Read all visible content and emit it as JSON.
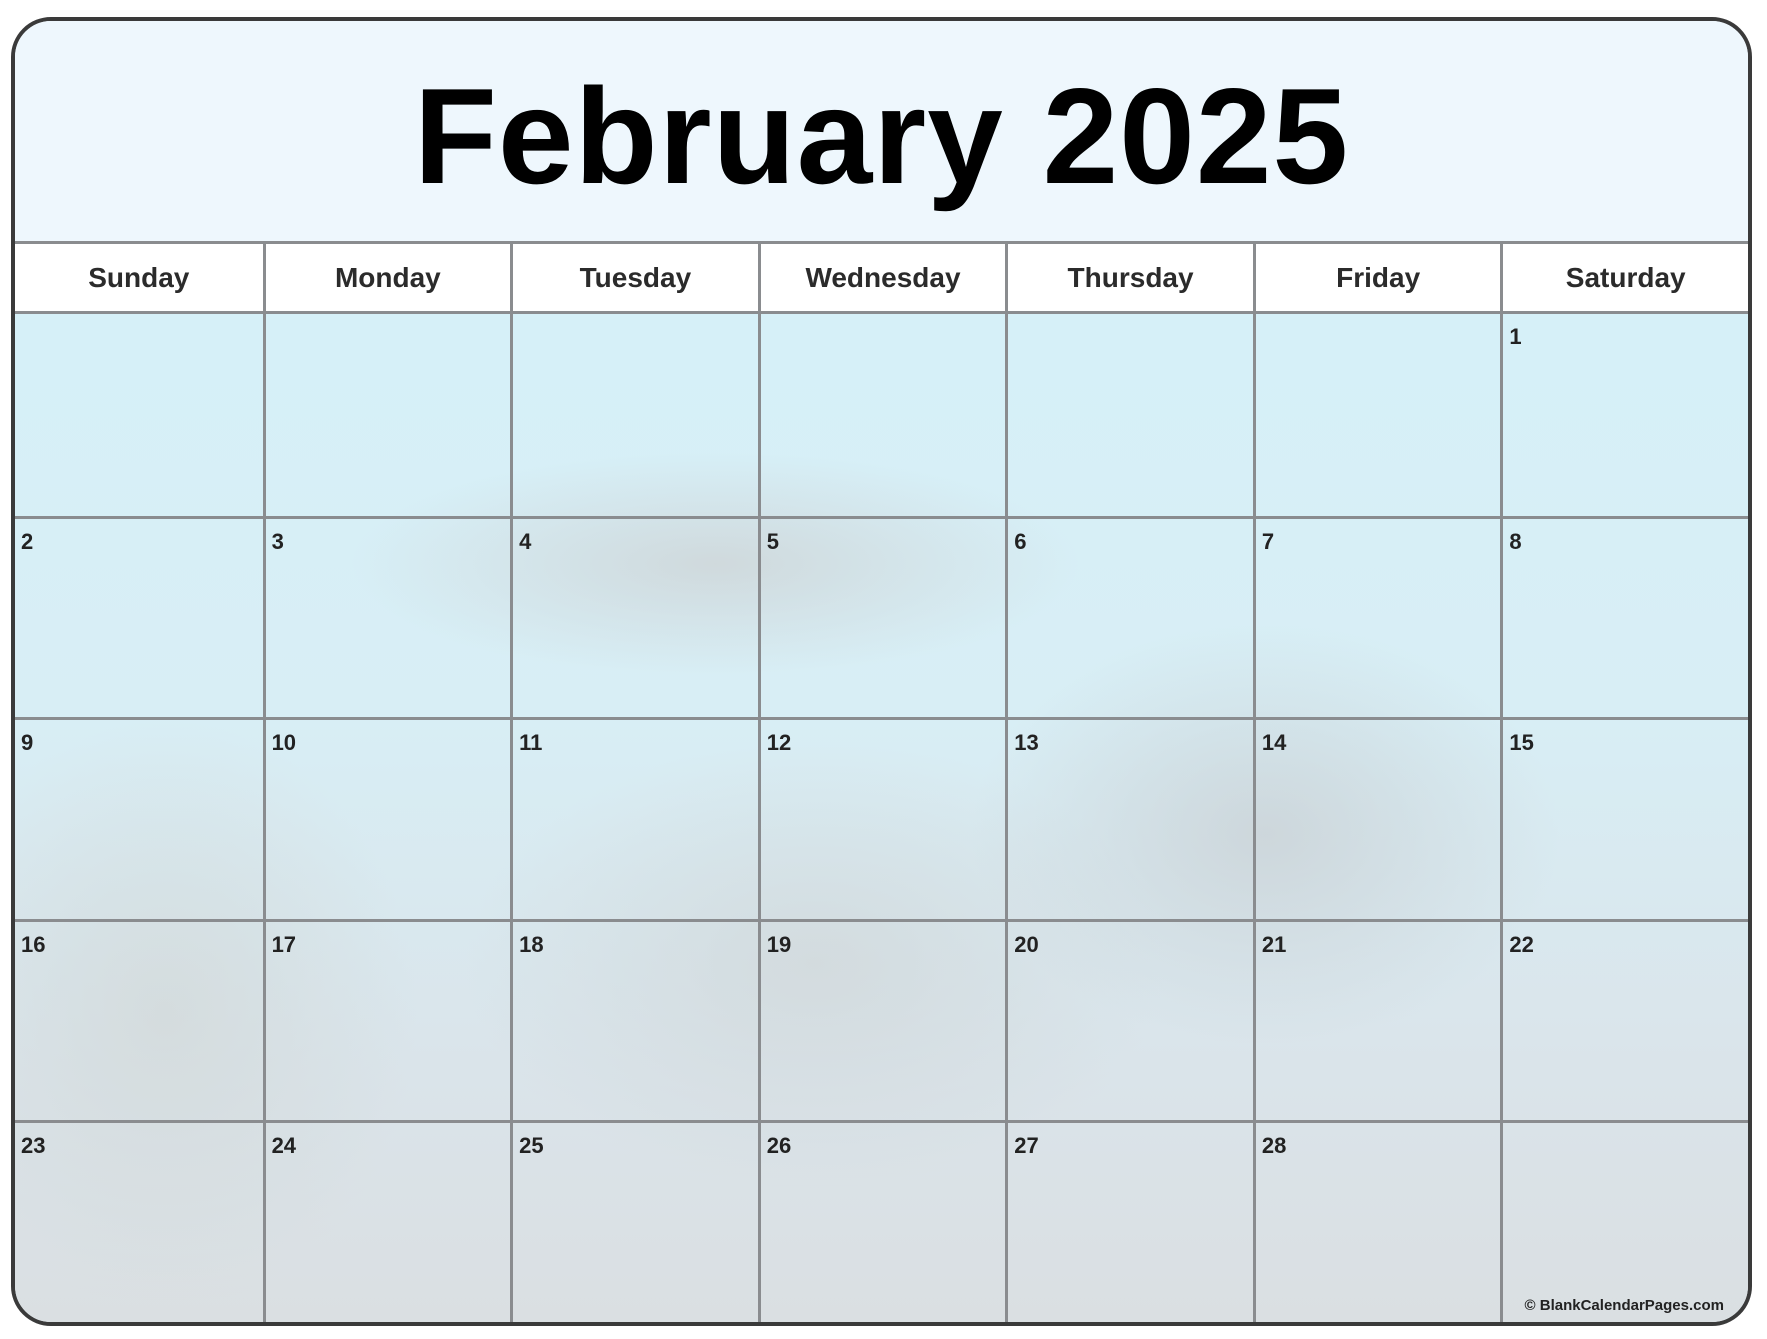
{
  "calendar": {
    "title": "February 2025",
    "weekdays": [
      "Sunday",
      "Monday",
      "Tuesday",
      "Wednesday",
      "Thursday",
      "Friday",
      "Saturday"
    ],
    "weeks": [
      [
        "",
        "",
        "",
        "",
        "",
        "",
        "1"
      ],
      [
        "2",
        "3",
        "4",
        "5",
        "6",
        "7",
        "8"
      ],
      [
        "9",
        "10",
        "11",
        "12",
        "13",
        "14",
        "15"
      ],
      [
        "16",
        "17",
        "18",
        "19",
        "20",
        "21",
        "22"
      ],
      [
        "23",
        "24",
        "25",
        "26",
        "27",
        "28",
        ""
      ]
    ],
    "copyright": "© BlankCalendarPages.com",
    "background_image": "sea-turtle-underwater"
  },
  "colors": {
    "title_band": "#eef7fd",
    "grid_line": "#8a8c8f",
    "frame_border": "#3a3a3a",
    "cell_bg_top": "#d6f0f8",
    "cell_bg_bottom": "#dadfe2"
  }
}
